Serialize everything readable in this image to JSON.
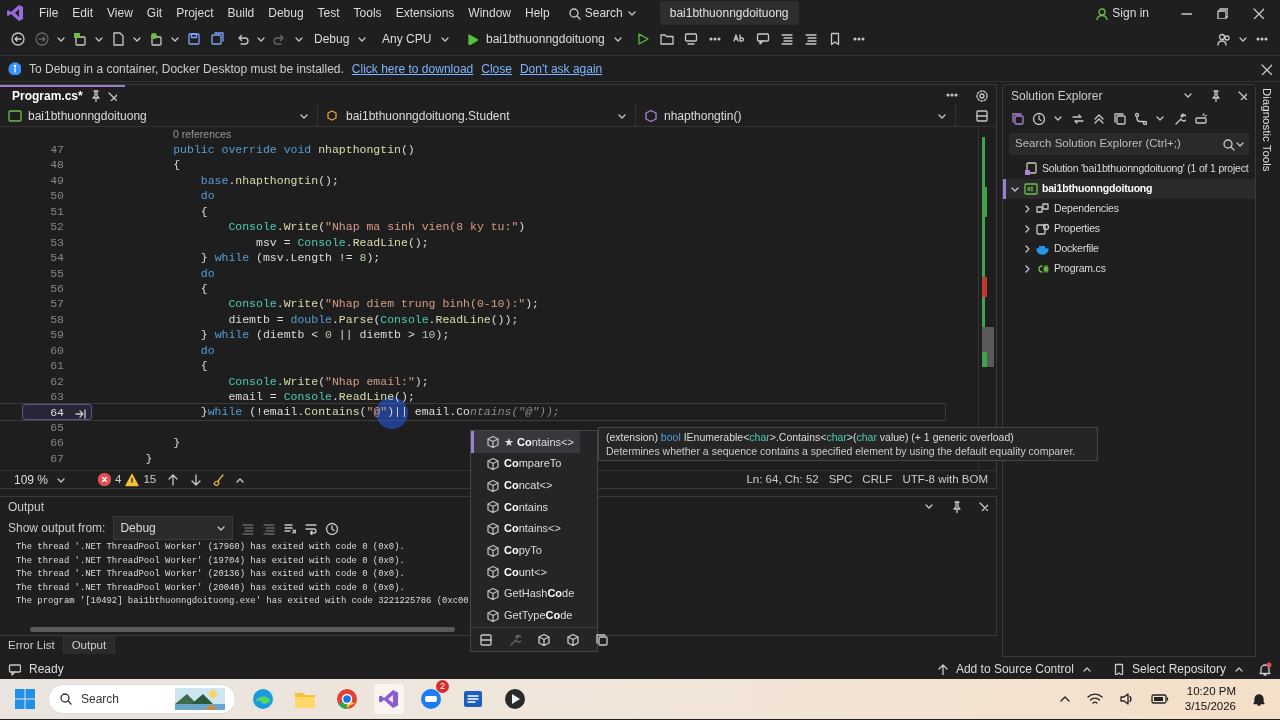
{
  "menu": {
    "items": [
      "File",
      "Edit",
      "View",
      "Git",
      "Project",
      "Build",
      "Debug",
      "Test",
      "Tools",
      "Extensions",
      "Window",
      "Help"
    ],
    "search": "Search",
    "solution_name": "bai1bthuonngdoituong",
    "sign_in": "Sign in"
  },
  "toolbar": {
    "configuration": "Debug",
    "platform": "Any CPU",
    "start_target": "bai1bthuonngdoituong"
  },
  "info_bar": {
    "message": "To Debug in a container, Docker Desktop must be installed.",
    "links": [
      "Click here to download",
      "Close",
      "Don't ask again"
    ]
  },
  "editor": {
    "tabs": [
      {
        "label": "Program.cs*",
        "selected": true
      }
    ],
    "nav": [
      "bai1bthuonngdoituong",
      "bai1bthuonngdoituong.Student",
      "nhapthongtin()"
    ],
    "codelens": "0 references",
    "lines": [
      {
        "number": "47",
        "current": false,
        "tokens": [
          {
            "kind": "kw",
            "text": "        public override void "
          },
          {
            "kind": "method",
            "text": "nhapthongtin"
          },
          {
            "kind": "plain",
            "text": "()"
          }
        ]
      },
      {
        "number": "48",
        "current": false,
        "tokens": [
          {
            "kind": "plain",
            "text": "        {"
          }
        ]
      },
      {
        "number": "49",
        "current": false,
        "tokens": [
          {
            "kind": "kw",
            "text": "            base"
          },
          {
            "kind": "plain",
            "text": "."
          },
          {
            "kind": "method",
            "text": "nhapthongtin"
          },
          {
            "kind": "plain",
            "text": "();"
          }
        ]
      },
      {
        "number": "50",
        "current": false,
        "tokens": [
          {
            "kind": "kw",
            "text": "            do"
          }
        ]
      },
      {
        "number": "51",
        "current": false,
        "tokens": [
          {
            "kind": "plain",
            "text": "            {"
          }
        ]
      },
      {
        "number": "52",
        "current": false,
        "tokens": [
          {
            "kind": "type",
            "text": "                Console"
          },
          {
            "kind": "plain",
            "text": "."
          },
          {
            "kind": "method",
            "text": "Write"
          },
          {
            "kind": "plain",
            "text": "("
          },
          {
            "kind": "str",
            "text": "\"Nhap ma sinh vien(8 ky tu:\""
          },
          {
            "kind": "plain",
            "text": ")"
          }
        ]
      },
      {
        "number": "53",
        "current": false,
        "tokens": [
          {
            "kind": "plain",
            "text": "                    msv = "
          },
          {
            "kind": "type",
            "text": "Console"
          },
          {
            "kind": "plain",
            "text": "."
          },
          {
            "kind": "method",
            "text": "ReadLine"
          },
          {
            "kind": "plain",
            "text": "();"
          }
        ]
      },
      {
        "number": "54",
        "current": false,
        "tokens": [
          {
            "kind": "plain",
            "text": "            } "
          },
          {
            "kind": "kw",
            "text": "while"
          },
          {
            "kind": "plain",
            "text": " (msv.Length != "
          },
          {
            "kind": "num",
            "text": "8"
          },
          {
            "kind": "plain",
            "text": ");"
          }
        ]
      },
      {
        "number": "55",
        "current": false,
        "tokens": [
          {
            "kind": "kw",
            "text": "            do"
          }
        ]
      },
      {
        "number": "56",
        "current": false,
        "tokens": [
          {
            "kind": "plain",
            "text": "            {"
          }
        ]
      },
      {
        "number": "57",
        "current": false,
        "tokens": [
          {
            "kind": "type",
            "text": "                Console"
          },
          {
            "kind": "plain",
            "text": "."
          },
          {
            "kind": "method",
            "text": "Write"
          },
          {
            "kind": "plain",
            "text": "("
          },
          {
            "kind": "str",
            "text": "\"Nhap diem trung binh(0-10):\""
          },
          {
            "kind": "plain",
            "text": ");"
          }
        ]
      },
      {
        "number": "58",
        "current": false,
        "tokens": [
          {
            "kind": "plain",
            "text": "                diemtb = "
          },
          {
            "kind": "kw",
            "text": "double"
          },
          {
            "kind": "plain",
            "text": "."
          },
          {
            "kind": "method",
            "text": "Parse"
          },
          {
            "kind": "plain",
            "text": "("
          },
          {
            "kind": "type",
            "text": "Console"
          },
          {
            "kind": "plain",
            "text": "."
          },
          {
            "kind": "method",
            "text": "ReadLine"
          },
          {
            "kind": "plain",
            "text": "());"
          }
        ]
      },
      {
        "number": "59",
        "current": false,
        "tokens": [
          {
            "kind": "plain",
            "text": "            } "
          },
          {
            "kind": "kw",
            "text": "while"
          },
          {
            "kind": "plain",
            "text": " (diemtb < "
          },
          {
            "kind": "num",
            "text": "0"
          },
          {
            "kind": "plain",
            "text": " || diemtb > "
          },
          {
            "kind": "num",
            "text": "10"
          },
          {
            "kind": "plain",
            "text": ");"
          }
        ]
      },
      {
        "number": "60",
        "current": false,
        "tokens": [
          {
            "kind": "kw",
            "text": "            do"
          }
        ]
      },
      {
        "number": "61",
        "current": false,
        "tokens": [
          {
            "kind": "plain",
            "text": "            {"
          }
        ]
      },
      {
        "number": "62",
        "current": false,
        "tokens": [
          {
            "kind": "type",
            "text": "                Console"
          },
          {
            "kind": "plain",
            "text": "."
          },
          {
            "kind": "method",
            "text": "Write"
          },
          {
            "kind": "plain",
            "text": "("
          },
          {
            "kind": "str",
            "text": "\"Nhap email:\""
          },
          {
            "kind": "plain",
            "text": ");"
          }
        ]
      },
      {
        "number": "63",
        "current": false,
        "tokens": [
          {
            "kind": "plain",
            "text": "                email = "
          },
          {
            "kind": "type",
            "text": "Console"
          },
          {
            "kind": "plain",
            "text": "."
          },
          {
            "kind": "method",
            "text": "ReadLine"
          },
          {
            "kind": "plain",
            "text": "();"
          }
        ]
      },
      {
        "number": "64",
        "current": true,
        "tokens": [
          {
            "kind": "plain",
            "text": "            }"
          },
          {
            "kind": "kw",
            "text": "while"
          },
          {
            "kind": "plain",
            "text": " (!email."
          },
          {
            "kind": "method",
            "text": "Contains"
          },
          {
            "kind": "plain",
            "text": "("
          },
          {
            "kind": "str",
            "text": "\"@\""
          },
          {
            "kind": "plain",
            "text": ")|| email.Co"
          },
          {
            "kind": "ghost",
            "text": "ntains(\"@\"));"
          }
        ]
      },
      {
        "number": "65",
        "current": false
      },
      {
        "number": "66",
        "current": false,
        "tokens": [
          {
            "kind": "plain",
            "text": "        }"
          }
        ]
      },
      {
        "number": "67",
        "current": false,
        "tokens": [
          {
            "kind": "plain",
            "text": "    }"
          }
        ]
      }
    ],
    "status": {
      "zoom": "109 %",
      "errors": "4",
      "warnings": "15",
      "position": "Ln: 64, Ch: 52",
      "indent": "SPC",
      "line_endings": "CRLF",
      "encoding": "UTF-8 with BOM"
    }
  },
  "completion": {
    "items": [
      {
        "label": "★ **Co**ntains<>",
        "selected": true
      },
      {
        "label": "**Co**mpareTo",
        "selected": false
      },
      {
        "label": "**Co**ncat<>",
        "selected": false
      },
      {
        "label": "**Co**ntains",
        "selected": false
      },
      {
        "label": "**Co**ntains<>",
        "selected": false
      },
      {
        "label": "**Co**pyTo",
        "selected": false
      },
      {
        "label": "**Co**unt<>",
        "selected": false
      },
      {
        "label": "GetHash**Co**de",
        "selected": false
      },
      {
        "label": "GetType**Co**de",
        "selected": false
      }
    ],
    "tooltip": {
      "signature": [
        {
          "kind": "plain",
          "text": "(extension) "
        },
        {
          "kind": "kw",
          "text": "bool"
        },
        {
          "kind": "plain",
          "text": " IEnumerable<"
        },
        {
          "kind": "type",
          "text": "char"
        },
        {
          "kind": "plain",
          "text": ">.Contains<"
        },
        {
          "kind": "type",
          "text": "char"
        },
        {
          "kind": "plain",
          "text": ">("
        },
        {
          "kind": "type",
          "text": "char"
        },
        {
          "kind": "plain",
          "text": " value) (+ 1 generic overload)"
        }
      ],
      "description": "Determines whether a sequence contains a specified element by using the default equality comparer."
    }
  },
  "output": {
    "title": "Output",
    "source_label": "Show output from:",
    "source": "Debug",
    "lines": [
      "The thread '.NET ThreadPool Worker' (17960) has exited with code 0 (0x0).",
      "The thread '.NET ThreadPool Worker' (19704) has exited with code 0 (0x0).",
      "The thread '.NET ThreadPool Worker' (20136) has exited with code 0 (0x0).",
      "The thread '.NET ThreadPool Worker' (20040) has exited with code 0 (0x0).",
      "The program '[10492] bai1bthuonngdoituong.exe' has exited with code 3221225786 (0xc00"
    ]
  },
  "bottom_tabs": [
    {
      "label": "Error List",
      "selected": false
    },
    {
      "label": "Output",
      "selected": true
    }
  ],
  "solution_explorer": {
    "title": "Solution Explorer",
    "search_placeholder": "Search Solution Explorer (Ctrl+;)",
    "tree": [
      {
        "label": "Solution 'bai1bthuonngdoituong' (1 of 1 project",
        "kind": "solution",
        "selected": false,
        "children": [
          {
            "label": "bai1bthuonngdoituong",
            "kind": "project",
            "selected": true,
            "expanded": true,
            "children": [
              {
                "label": "Dependencies",
                "kind": "dependencies",
                "selected": false,
                "expanded": false
              },
              {
                "label": "Properties",
                "kind": "properties",
                "selected": false,
                "expanded": false
              },
              {
                "label": "Dockerfile",
                "kind": "docker",
                "selected": false,
                "expanded": false
              },
              {
                "label": "Program.cs",
                "kind": "csharp",
                "selected": false,
                "expanded": false
              }
            ]
          }
        ]
      }
    ]
  },
  "diagnostic_tools": "Diagnostic Tools",
  "status_bar": {
    "state": "Ready",
    "source_control": "Add to Source Control",
    "repository": "Select Repository"
  },
  "taskbar": {
    "search": "Search",
    "badge": "2",
    "time": "10:20 PM",
    "date": "3/15/2026"
  }
}
